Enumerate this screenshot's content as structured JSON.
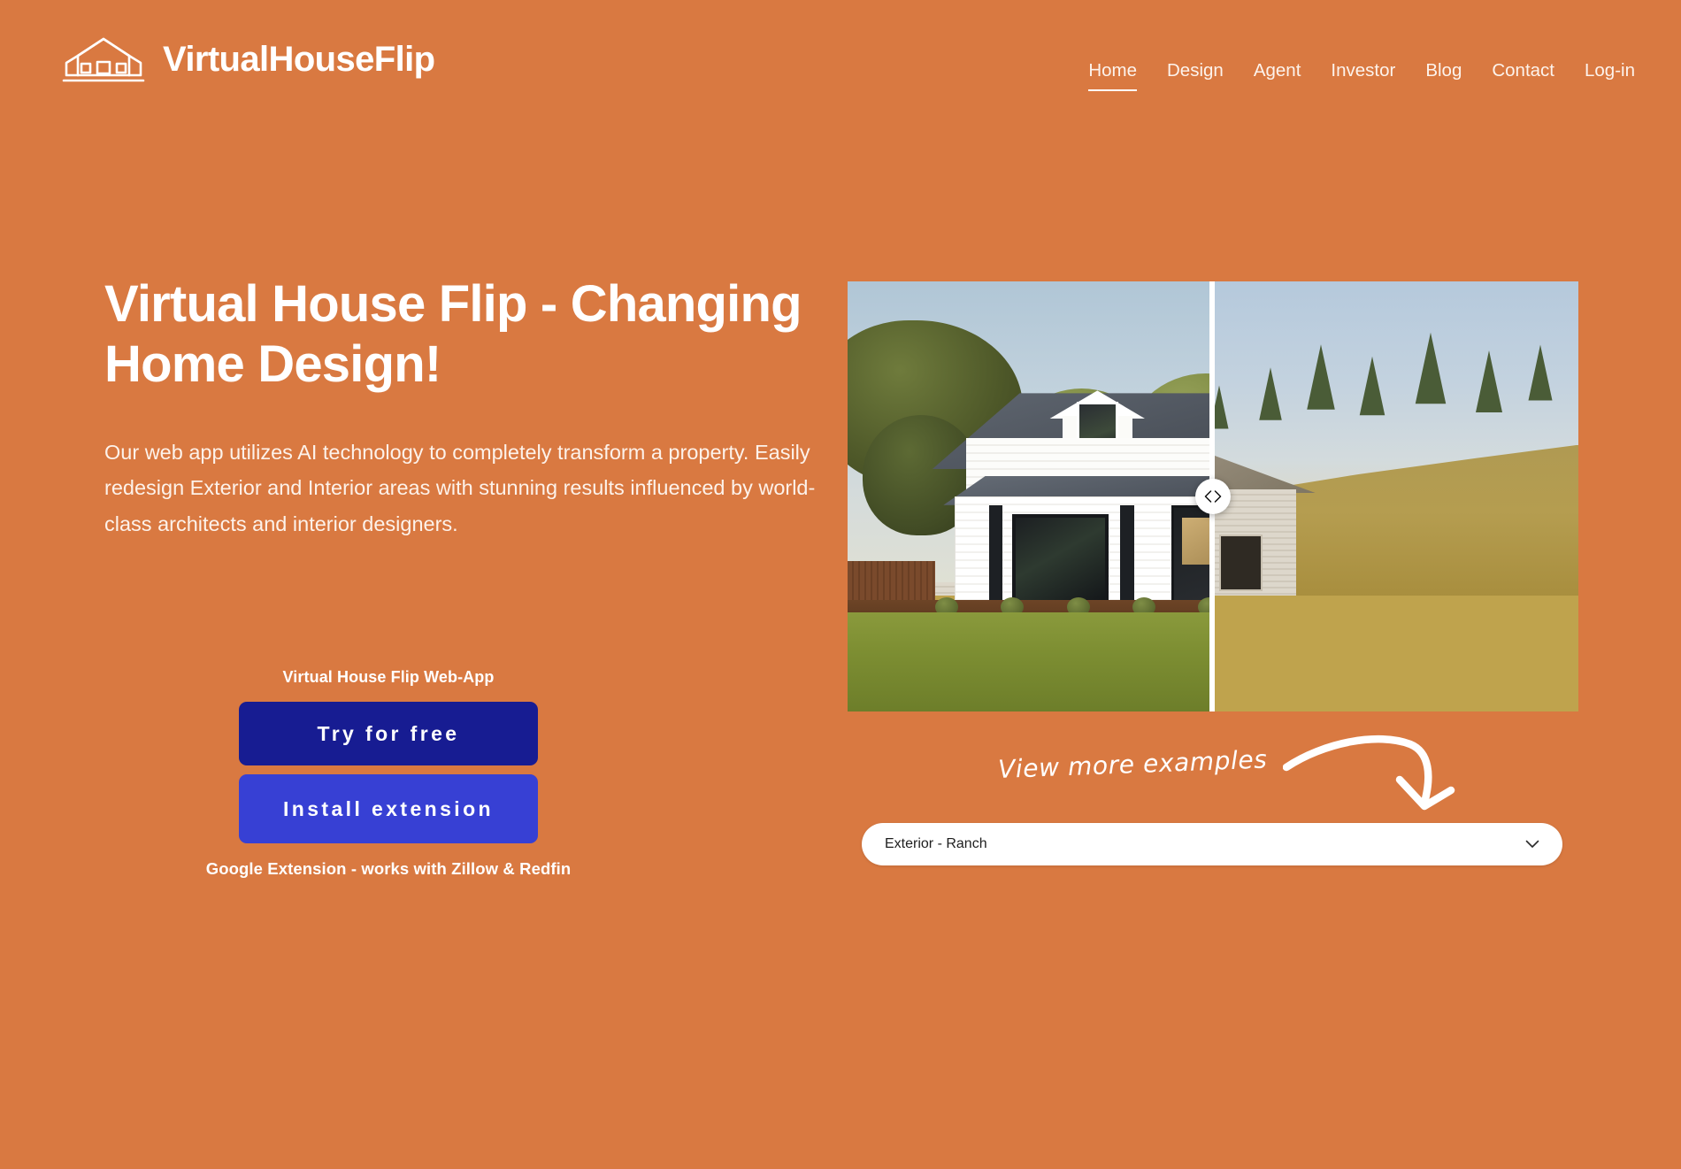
{
  "brand": {
    "name": "VirtualHouseFlip",
    "icon": "house-outline-icon"
  },
  "nav": {
    "items": [
      {
        "label": "Home",
        "active": true
      },
      {
        "label": "Design",
        "active": false
      },
      {
        "label": "Agent",
        "active": false
      },
      {
        "label": "Investor",
        "active": false
      },
      {
        "label": "Blog",
        "active": false
      },
      {
        "label": "Contact",
        "active": false
      },
      {
        "label": "Log-in",
        "active": false
      }
    ]
  },
  "hero": {
    "headline": "Virtual House Flip -  Changing Home Design!",
    "paragraph": "Our web app utilizes AI technology to completely transform a property. Easily redesign Exterior and Interior areas with stunning results influenced by world-class architects and interior designers."
  },
  "cta": {
    "caption_top": "Virtual House Flip Web-App",
    "primary_label": "Try for free",
    "secondary_label": "Install extension",
    "caption_bottom": "Google Extension - works with Zillow & Redfin"
  },
  "comparison": {
    "handle_icon_left": "chevron-left-icon",
    "handle_icon_right": "chevron-right-icon",
    "after_alt": "Renovated white farmhouse with dark shingled roof, dormer windows, covered porch and green lawn",
    "before_alt": "Derelict weathered white clapboard farmhouse with brick chimney in dry golden grass",
    "divider_position_percent": 50
  },
  "examples": {
    "note": "View more examples",
    "arrow_icon": "curved-arrow-down-right-icon"
  },
  "style_select": {
    "value": "Exterior - Ranch",
    "chevron_icon": "chevron-down-icon",
    "options": [
      "Exterior - Ranch"
    ]
  },
  "colors": {
    "background": "#d97941",
    "primary_button": "#171c92",
    "secondary_button": "#3740d4",
    "text_on_orange": "#ffffff",
    "select_background": "#ffffff"
  }
}
